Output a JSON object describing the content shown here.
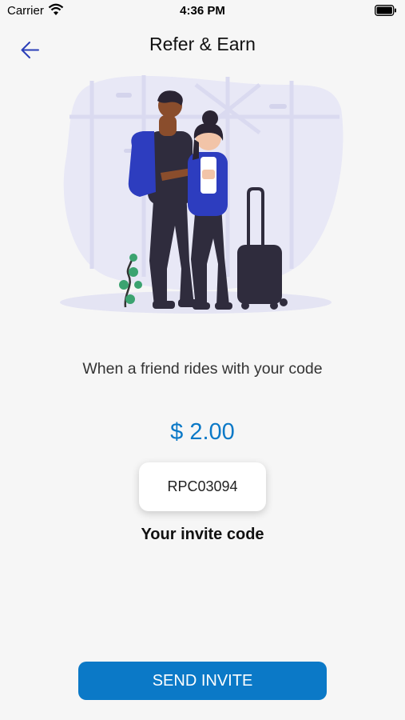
{
  "status_bar": {
    "carrier": "Carrier",
    "time": "4:36 PM"
  },
  "header": {
    "title": "Refer & Earn",
    "back_icon": "arrow-left-icon"
  },
  "referral": {
    "description": "When a friend rides with your code",
    "amount": "$ 2.00",
    "code": "RPC03094",
    "code_caption": "Your invite code"
  },
  "actions": {
    "send_invite_label": "SEND INVITE"
  },
  "colors": {
    "accent": "#0b79c7",
    "background": "#f6f6f6",
    "back_arrow": "#2b3fb8"
  }
}
